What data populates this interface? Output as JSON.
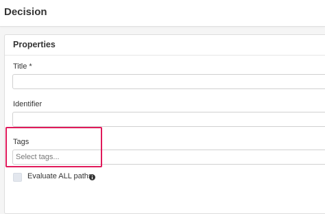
{
  "header": {
    "title": "Decision"
  },
  "properties": {
    "section_title": "Properties",
    "title_label": "Title *",
    "title_value": "",
    "identifier_label": "Identifier",
    "identifier_value": "",
    "tags_label": "Tags",
    "tags_placeholder": "Select tags...",
    "evaluate_label": "Evaluate ALL paths",
    "evaluate_checked": false
  },
  "icons": {
    "info": "info-circle-icon"
  },
  "colors": {
    "highlight": "#e0195a",
    "background": "#f5f5f5",
    "panel": "#ffffff"
  }
}
